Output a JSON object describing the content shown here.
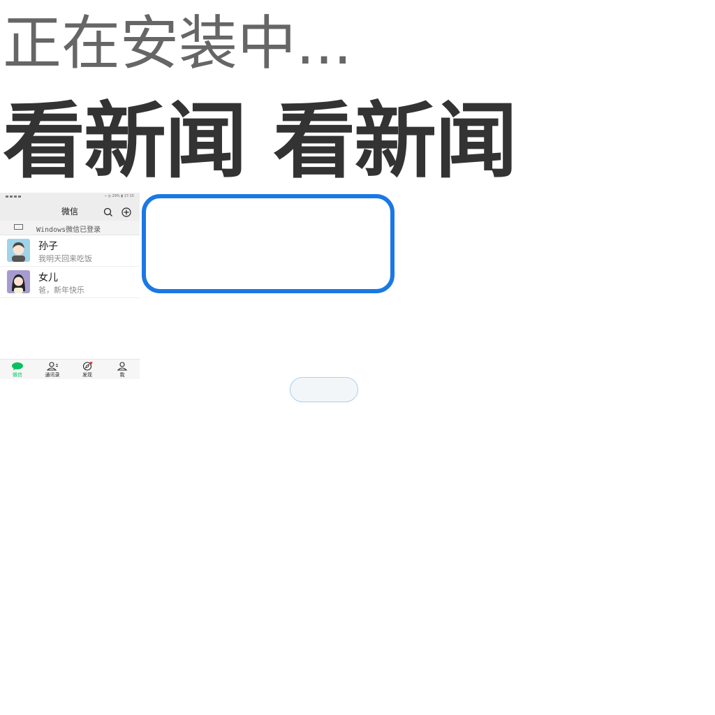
{
  "status": {
    "installing": "正在安装中..."
  },
  "headline": {
    "text": "看新闻 看新闻"
  },
  "phone": {
    "title": "微信",
    "status_bar_right": "⌁ ◎ 29% ▮ 17:15",
    "login_notice": "Windows微信已登录",
    "chats": [
      {
        "name": "孙子",
        "message": "我明天回来吃饭"
      },
      {
        "name": "女儿",
        "message": "爸，新年快乐"
      }
    ],
    "tabs": [
      {
        "label": "微信",
        "icon": "chat-bubble-icon"
      },
      {
        "label": "通讯录",
        "icon": "contacts-icon"
      },
      {
        "label": "发现",
        "icon": "compass-icon"
      },
      {
        "label": "我",
        "icon": "person-icon"
      }
    ]
  },
  "colors": {
    "accent_blue": "#1a78e6",
    "wechat_green": "#07c160",
    "text_gray": "#666666",
    "headline_dark": "#333333"
  }
}
